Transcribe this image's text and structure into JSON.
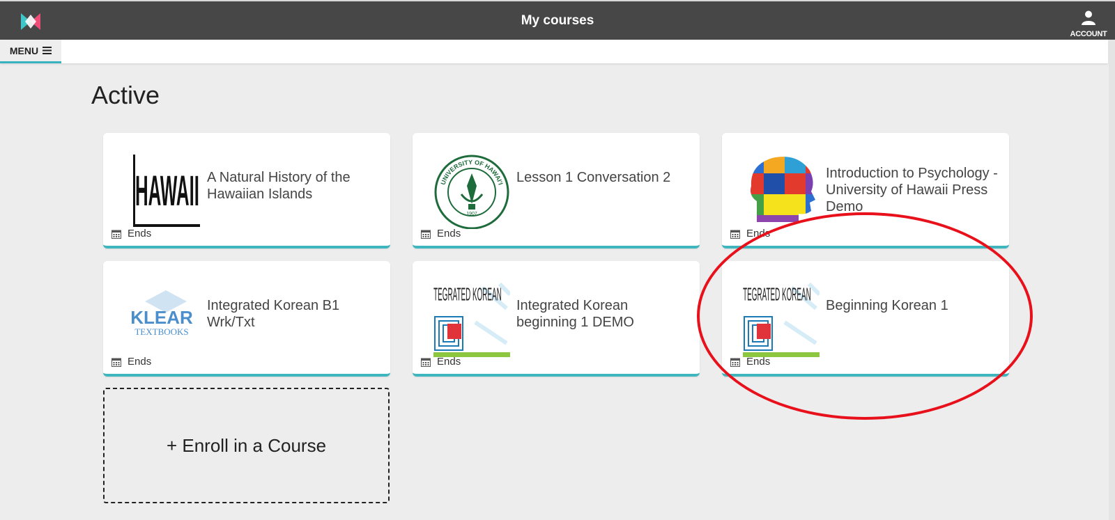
{
  "header": {
    "title": "My courses",
    "account_label": "ACCOUNT",
    "logo_icon": "app-logo-icon",
    "account_icon": "user-icon"
  },
  "menubar": {
    "menu_label": "MENU",
    "menu_icon": "hamburger-icon"
  },
  "section": {
    "title": "Active"
  },
  "courses": [
    {
      "title": "A Natural History of the Hawaiian Islands",
      "footer": "Ends",
      "thumb_text": "HAWAII"
    },
    {
      "title": "Lesson 1 Conversation 2",
      "footer": "Ends",
      "seal_text": "UNIVERSITY OF HAWAI'I",
      "seal_year": "1907"
    },
    {
      "title": "Introduction to Psychology - University of Hawaii Press Demo",
      "footer": "Ends"
    },
    {
      "title": "Integrated Korean B1 Wrk/Txt",
      "footer": "Ends",
      "thumb_text": "KLEAR",
      "thumb_subtext": "TEXTBOOKS"
    },
    {
      "title": "Integrated Korean beginning 1 DEMO",
      "footer": "Ends",
      "thumb_text": "INTEGRATED KOREAN"
    },
    {
      "title": "Beginning Korean 1",
      "footer": "Ends",
      "thumb_text": "INTEGRATED KOREAN"
    }
  ],
  "enroll": {
    "label": "+ Enroll in a Course"
  },
  "colors": {
    "header_bg": "#474747",
    "accent": "#3fb5bd",
    "highlight": "#e8101a",
    "page_bg": "#ededed"
  }
}
